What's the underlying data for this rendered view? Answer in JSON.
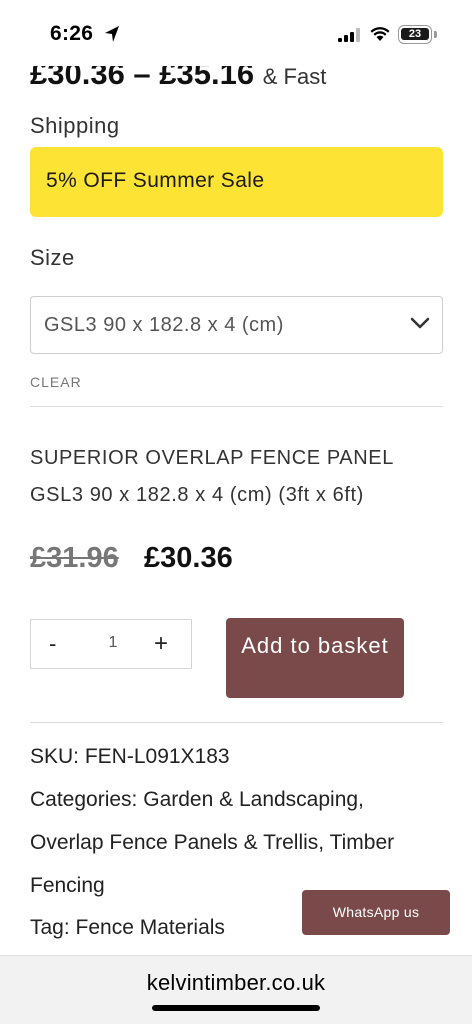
{
  "status_bar": {
    "time": "6:26",
    "battery": "23"
  },
  "product": {
    "price_range": "£30.36 – £35.16",
    "shipping_inline": "& Fast",
    "shipping_word": "Shipping",
    "sale_banner": "5% OFF Summer Sale",
    "size_label": "Size",
    "size_selected": "GSL3 90 x 182.8 x 4 (cm)",
    "clear_label": "CLEAR",
    "variant_line1": "SUPERIOR OVERLAP FENCE PANEL",
    "variant_line2": "GSL3 90 x 182.8 x 4 (cm) (3ft x 6ft)",
    "old_price": "£31.96",
    "new_price": "£30.36",
    "quantity": "1",
    "qty_minus": "-",
    "qty_plus": "+",
    "add_to_basket": "Add to basket"
  },
  "meta": {
    "sku_label": "SKU: FEN-L091X183",
    "categories_label": "Categories:",
    "category_1": "Garden & Landscaping,",
    "category_2": "Overlap Fence Panels & Trellis,",
    "category_3": "Timber",
    "category_3b": "Fencing",
    "tag_label": "Tag:",
    "tag_1": "Fence Materials"
  },
  "whatsapp_label": "WhatsApp us",
  "browser": {
    "url": "kelvintimber.co.uk"
  },
  "colors": {
    "sale_yellow": "#fde334",
    "brand_brown": "#7a4a4a"
  }
}
